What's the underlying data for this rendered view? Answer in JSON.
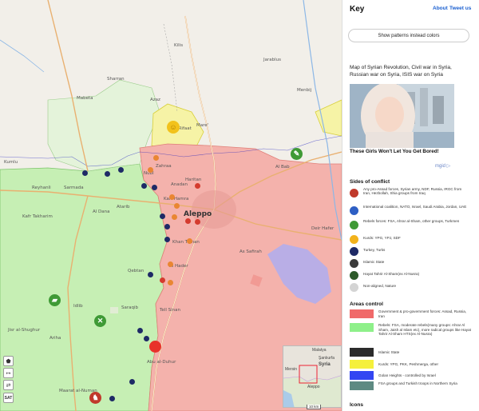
{
  "panel": {
    "title": "Key",
    "about_link": "About",
    "tweet_link": "Tweet us",
    "patterns_button": "Show patterns instead colors",
    "ad_text": "Map of Syrian Revolution, Civil war in Syria, Russian war on Syria, ISIS war on Syria",
    "ad_caption": "These Girls Won't Let You Get Bored!",
    "ad_brand": "mgid ▷",
    "sides_title": "Sides of conflict",
    "sides": [
      {
        "label": "Any pro-Assad forces, Syrian army, NDF, Russia, IRGC from Iran, Hezbollah, Shia groups from Iraq",
        "color": "#c0392b"
      },
      {
        "label": "International coalition, NATO, Israel, Saudi Arabia, Jordan, UAE",
        "color": "#2e5fc4"
      },
      {
        "label": "Rebels forces: FSA, Ahrar al-Sham, other groups, Turkmen",
        "color": "#3f9a36"
      },
      {
        "label": "Kurds: YPG, YPJ, SDF",
        "color": "#f2b21b"
      },
      {
        "label": "Turkey, Turks",
        "color": "#1e2a66"
      },
      {
        "label": "Islamic State",
        "color": "#3a3a3a"
      },
      {
        "label": "Hayat Tahrir Al-Sham(ex Al-Nusra)",
        "color": "#2d5a2a"
      },
      {
        "label": "Non-aligned, Nature",
        "color": "#d4d4d4"
      }
    ],
    "areas_title": "Areas control",
    "areas": [
      {
        "label": "Government & pro-government forces: Assad, Russia, Iran",
        "color": "#f06a6a"
      },
      {
        "label": "Rebels: FSA, moderate rebels(many groups: Ahrar Al Sham, Jaish al Islam etc), more radical groups like Hayat Tahrir Al-Sham HTS(ex Al-Nusra)",
        "color": "#8ef08a"
      },
      {
        "label": "Islamic State",
        "color": "#2b2b2b"
      },
      {
        "label": "Kurds: YPG, PKK, Peshmerga, other",
        "color": "#f5f03c"
      },
      {
        "label": "Golan Heights - controlled by Israel",
        "color": "#3346f2"
      },
      {
        "label": "FSA groups and Turkish troops in Northern Syria",
        "color": "#5e8a82"
      }
    ],
    "icons_title": "Icons"
  },
  "map": {
    "city_main": "Aleppo",
    "places": [
      "Aleppo",
      "Kilis",
      "Azaz",
      "Tell Rifaat",
      "Mare'",
      "Al Bab",
      "Deir Hafer",
      "As Safirah",
      "Zahraa",
      "Nubl",
      "Kafr Hamra",
      "Atarib",
      "Al Dana",
      "Kafr Takharim",
      "Idlib",
      "Ariha",
      "Saraqib",
      "Maarat al-Numan",
      "Abu al-Duhur",
      "Tell Sinan",
      "Qebtan",
      "Haritan",
      "Anadan",
      "Khan Tuman",
      "Al Hader",
      "Sarmada",
      "Jisr al-Shughur",
      "Kumlu",
      "Reyhanli",
      "Sharran",
      "Mabeta",
      "Jarablus",
      "Menbij"
    ],
    "controls": [
      "⬟",
      "↦",
      "⇄",
      "SAT"
    ],
    "minimap_labels": [
      "Malatya",
      "Mersin",
      "Aleppo",
      "Syria",
      "Şanlıurfa"
    ],
    "scale_label": "10 km"
  },
  "colors": {
    "government": "#f4aaaa",
    "rebels": "#bfeeaa",
    "kurds": "#f6f3a6",
    "is": "#b9aee6",
    "border": "#1b1bbf"
  }
}
